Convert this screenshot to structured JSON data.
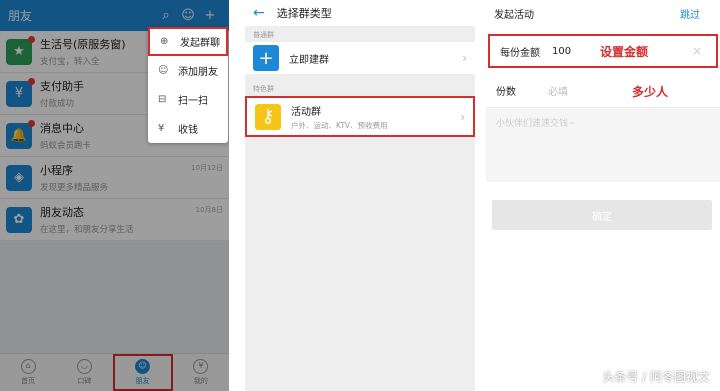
{
  "panel1": {
    "title": "朋友",
    "rows": [
      {
        "name": "生活号(原服务窗)",
        "sub": "支付宝，转入全",
        "date": "",
        "color": "#2e9e5b",
        "icon": "★",
        "dot": true
      },
      {
        "name": "支付助手",
        "sub": "付款成功",
        "date": "",
        "color": "#1e88d6",
        "icon": "¥",
        "dot": true
      },
      {
        "name": "消息中心",
        "sub": "蚂蚁会员跑卡",
        "date": "",
        "color": "#1e88d6",
        "icon": "🔔",
        "dot": true
      },
      {
        "name": "小程序",
        "sub": "发现更多精品服务",
        "date": "10月12日",
        "color": "#1e88d6",
        "icon": "◈",
        "dot": false
      },
      {
        "name": "朋友动态",
        "sub": "在这里，和朋友分享生活",
        "date": "10月8日",
        "color": "#1e88d6",
        "icon": "✿",
        "dot": false
      }
    ],
    "menu": [
      "发起群聊",
      "添加朋友",
      "扫一扫",
      "收钱"
    ],
    "tabs": [
      "首页",
      "口碑",
      "朋友",
      "我的"
    ]
  },
  "panel2": {
    "title": "选择群类型",
    "section1": "普通群",
    "item1": "立即建群",
    "section2": "特色群",
    "item2_title": "活动群",
    "item2_sub": "户外、运动、KTV、预收费用"
  },
  "panel3": {
    "title": "发起活动",
    "skip": "跳过",
    "amount_label": "每份金额",
    "amount_value": "100",
    "amount_note": "设置金额",
    "count_label": "份数",
    "count_placeholder": "必填",
    "count_note": "多少人",
    "greeting_placeholder": "小伙伴们速速交钱~",
    "confirm": "确定"
  },
  "watermark": "头条号 / 阿冬图视文"
}
